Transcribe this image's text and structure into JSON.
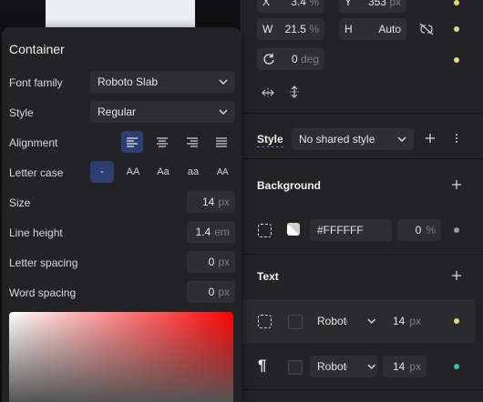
{
  "inspector": {
    "top_row": {
      "x_label": "X",
      "x_value": "3.4",
      "x_unit": "%",
      "y_label": "Y",
      "y_value": "353",
      "y_unit": "px"
    },
    "size_row": {
      "w_label": "W",
      "w_value": "21.5",
      "w_unit": "%",
      "h_label": "H",
      "h_value": "Auto"
    },
    "rotation": {
      "value": "0",
      "unit": "deg"
    },
    "style": {
      "label": "Style",
      "select_value": "No shared style"
    },
    "background": {
      "title": "Background",
      "hex": "#FFFFFF",
      "opacity": "0",
      "opacity_unit": "%"
    },
    "text": {
      "title": "Text",
      "rows": [
        {
          "font": "Roboto Slab",
          "size": "14",
          "unit": "px",
          "dot_color": "#e8d77a"
        },
        {
          "font": "Roboto Slab",
          "size": "14",
          "unit": "px",
          "dot_color": "#2fc1b2"
        }
      ]
    },
    "colors": {
      "yellow_dot": "#e8d77a",
      "gray_dot": "#9a9a9e",
      "teal_dot": "#2fc1b2"
    }
  },
  "popover": {
    "title": "Container",
    "font_family": {
      "label": "Font family",
      "value": "Roboto Slab"
    },
    "style": {
      "label": "Style",
      "value": "Regular"
    },
    "alignment": {
      "label": "Alignment",
      "selected": "left"
    },
    "letter_case": {
      "label": "Letter case",
      "options": [
        "-",
        "AA",
        "Aa",
        "aa",
        "AA"
      ]
    },
    "size": {
      "label": "Size",
      "value": "14",
      "unit": "px"
    },
    "line_height": {
      "label": "Line height",
      "value": "1.4",
      "unit": "em"
    },
    "letter_spacing": {
      "label": "Letter spacing",
      "value": "0",
      "unit": "px"
    },
    "word_spacing": {
      "label": "Word spacing",
      "value": "0",
      "unit": "px"
    },
    "accent": "#2c3f70"
  }
}
